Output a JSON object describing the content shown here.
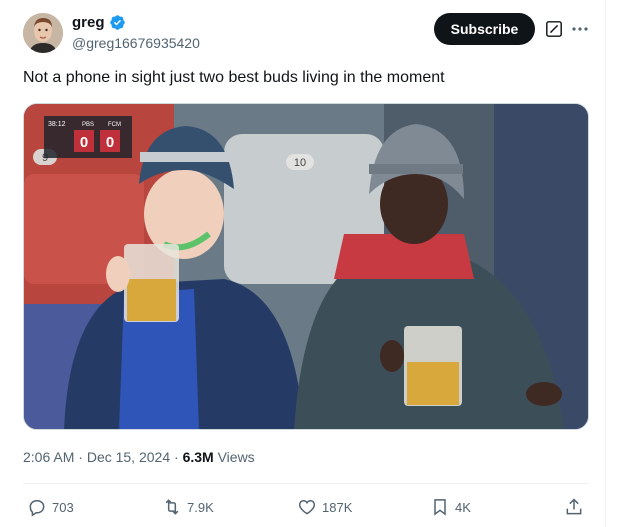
{
  "author": {
    "display_name": "greg",
    "handle": "@greg16676935420",
    "verified": true
  },
  "header": {
    "subscribe_label": "Subscribe"
  },
  "tweet": {
    "text": "Not a phone in sight just two best buds living in the moment",
    "time": "2:06 AM",
    "date": "Dec 15, 2024",
    "views_count": "6.3M",
    "views_label": "Views"
  },
  "media": {
    "scoreboard": {
      "clock": "38:12",
      "team_a": "PBS",
      "team_b": "FCM",
      "score_a": "0",
      "score_b": "0"
    },
    "seat_numbers": [
      "9",
      "10"
    ]
  },
  "actions": {
    "replies": "703",
    "reposts": "7.9K",
    "likes": "187K",
    "bookmarks": "4K"
  },
  "colors": {
    "accent": "#1d9bf0",
    "subscribe_bg": "#0f1419",
    "muted_text": "#536471"
  }
}
